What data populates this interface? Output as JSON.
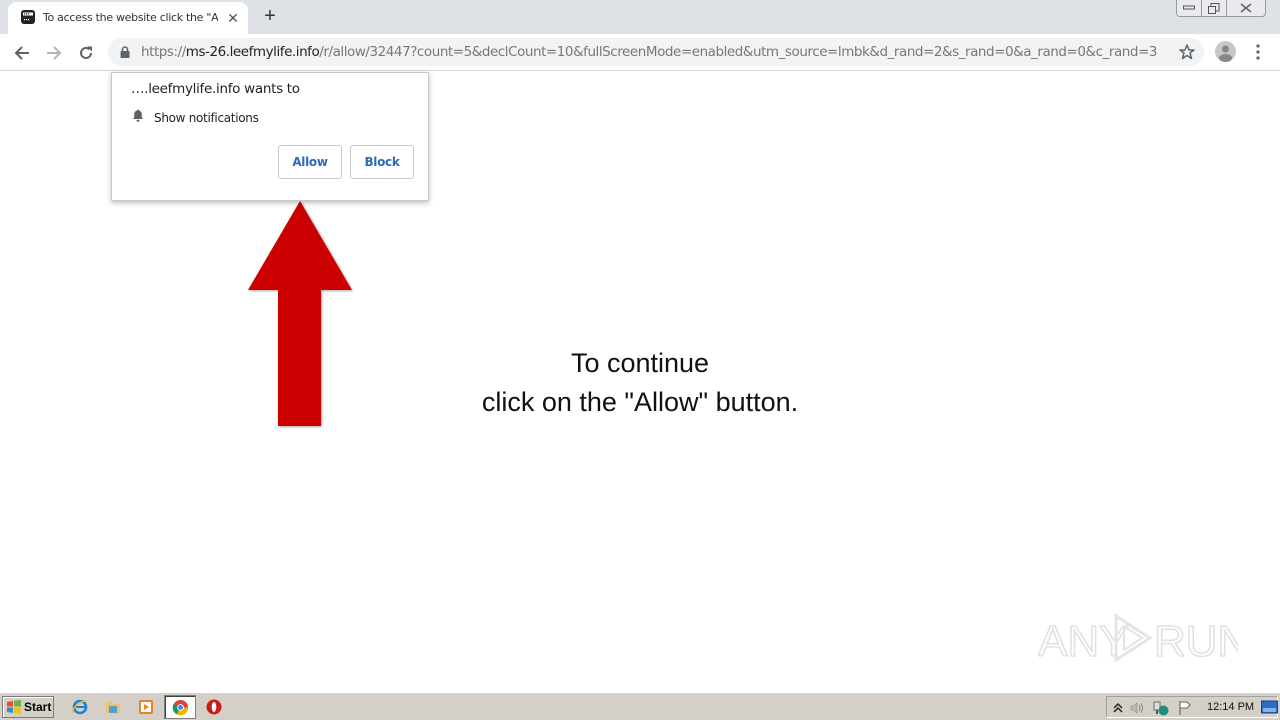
{
  "browser": {
    "tab": {
      "title": "To access the website click the \"Allow\" button",
      "close_label": "✕",
      "favicon": "browser-window-icon"
    },
    "new_tab_label": "+",
    "window_controls": [
      "minimize",
      "restore",
      "close"
    ],
    "nav": {
      "back": "back-arrow-icon",
      "forward": "forward-arrow-icon",
      "reload": "reload-icon"
    },
    "address_bar": {
      "scheme": "https://",
      "host": "ms-26.leefmylife.info",
      "path": "/r/allow/32447?count=5&declCount=10&fullScreenMode=enabled&utm_source=lmbk&d_rand=2&s_rand=0&a_rand=0&c_rand=3",
      "secure_icon": "lock-icon"
    }
  },
  "permission_popup": {
    "origin": "….leefmylife.info wants to",
    "permission": "Show notifications",
    "allow_label": "Allow",
    "block_label": "Block"
  },
  "page": {
    "line1": "To continue",
    "line2": "click on the \"Allow\" button.",
    "arrow_color": "#cc0000",
    "watermark_left": "ANY",
    "watermark_right": "RUN"
  },
  "taskbar": {
    "start_label": "Start",
    "pinned": [
      "internet-explorer",
      "windows-explorer",
      "media-player",
      "chrome",
      "opera"
    ],
    "clock": "12:14 PM"
  }
}
